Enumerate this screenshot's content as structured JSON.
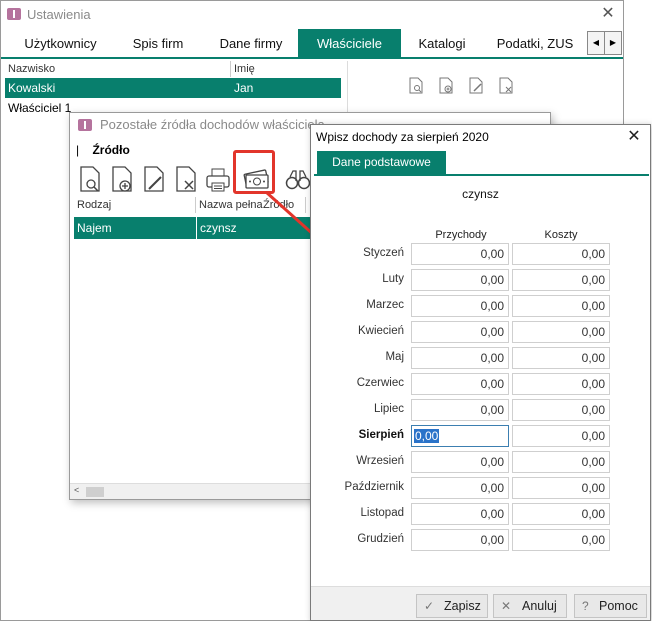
{
  "w1": {
    "title": "Ustawienia",
    "tabs": [
      {
        "label": "Użytkownicy",
        "active": false
      },
      {
        "label": "Spis firm",
        "active": false
      },
      {
        "label": "Dane firmy",
        "active": false
      },
      {
        "label": "Właściciele",
        "active": true
      },
      {
        "label": "Katalogi",
        "active": false
      },
      {
        "label": "Podatki, ZUS",
        "active": false
      }
    ],
    "tab_scroll_left": "◀",
    "tab_scroll_right": "▶",
    "columns": [
      "Nazwisko",
      "Imię"
    ],
    "rows": [
      {
        "nazwisko": "Kowalski",
        "imie": "Jan",
        "selected": true
      },
      {
        "nazwisko": "Właściciel 1",
        "imie": "",
        "selected": false
      }
    ]
  },
  "w2": {
    "title": "Pozostałe źródła dochodów właściciela",
    "menu_label": "Źródło",
    "columns": [
      "Rodzaj",
      "Nazwa pełna",
      "Źródło"
    ],
    "rows": [
      {
        "rodzaj": "Najem",
        "nazwa": "czynsz",
        "selected": true
      }
    ]
  },
  "w3": {
    "title": "Wpisz dochody za sierpień 2020",
    "tab": "Dane podstawowe",
    "subject": "czynsz",
    "col_przychody": "Przychody",
    "col_koszty": "Koszty",
    "months": [
      {
        "name": "Styczeń",
        "przychody": "0,00",
        "koszty": "0,00"
      },
      {
        "name": "Luty",
        "przychody": "0,00",
        "koszty": "0,00"
      },
      {
        "name": "Marzec",
        "przychody": "0,00",
        "koszty": "0,00"
      },
      {
        "name": "Kwiecień",
        "przychody": "0,00",
        "koszty": "0,00"
      },
      {
        "name": "Maj",
        "przychody": "0,00",
        "koszty": "0,00"
      },
      {
        "name": "Czerwiec",
        "przychody": "0,00",
        "koszty": "0,00"
      },
      {
        "name": "Lipiec",
        "przychody": "0,00",
        "koszty": "0,00"
      },
      {
        "name": "Sierpień",
        "przychody": "0,00",
        "koszty": "0,00",
        "current": true
      },
      {
        "name": "Wrzesień",
        "przychody": "0,00",
        "koszty": "0,00"
      },
      {
        "name": "Październik",
        "przychody": "0,00",
        "koszty": "0,00"
      },
      {
        "name": "Listopad",
        "przychody": "0,00",
        "koszty": "0,00"
      },
      {
        "name": "Grudzień",
        "przychody": "0,00",
        "koszty": "0,00"
      }
    ],
    "buttons": {
      "zapisz": "Zapisz",
      "anuluj": "Anuluj",
      "pomoc": "Pomoc"
    }
  },
  "accent_color": "#087f6d",
  "highlight_color": "#e2352b"
}
